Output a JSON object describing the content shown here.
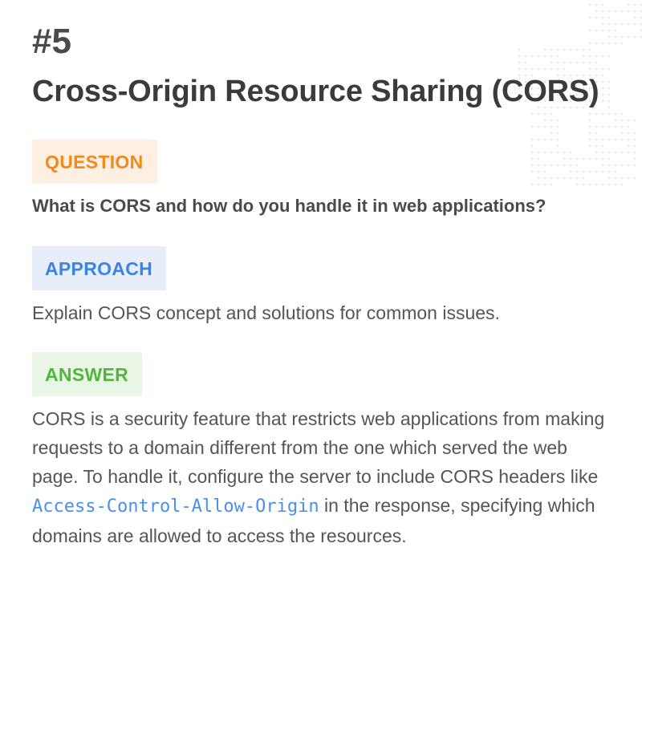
{
  "header": {
    "number": "#5",
    "title": "Cross-Origin Resource Sharing (CORS)"
  },
  "question": {
    "label": "QUESTION",
    "text": "What is CORS and how do you handle it in web applications?"
  },
  "approach": {
    "label": "APPROACH",
    "text": "Explain CORS concept and solutions for common issues."
  },
  "answer": {
    "label": "ANSWER",
    "text_before": "CORS is a security feature that restricts web applications from making requests to a domain different from the one which served the web page. To handle it, configure the server to include CORS headers like ",
    "code": "Access-Control-Allow-Origin",
    "text_after": " in the response, specifying which domains are allowed to access the resources."
  },
  "colors": {
    "question_accent": "#f08a1d",
    "approach_accent": "#3d82e8",
    "answer_accent": "#4fb83c",
    "code_color": "#4a8ff0"
  }
}
